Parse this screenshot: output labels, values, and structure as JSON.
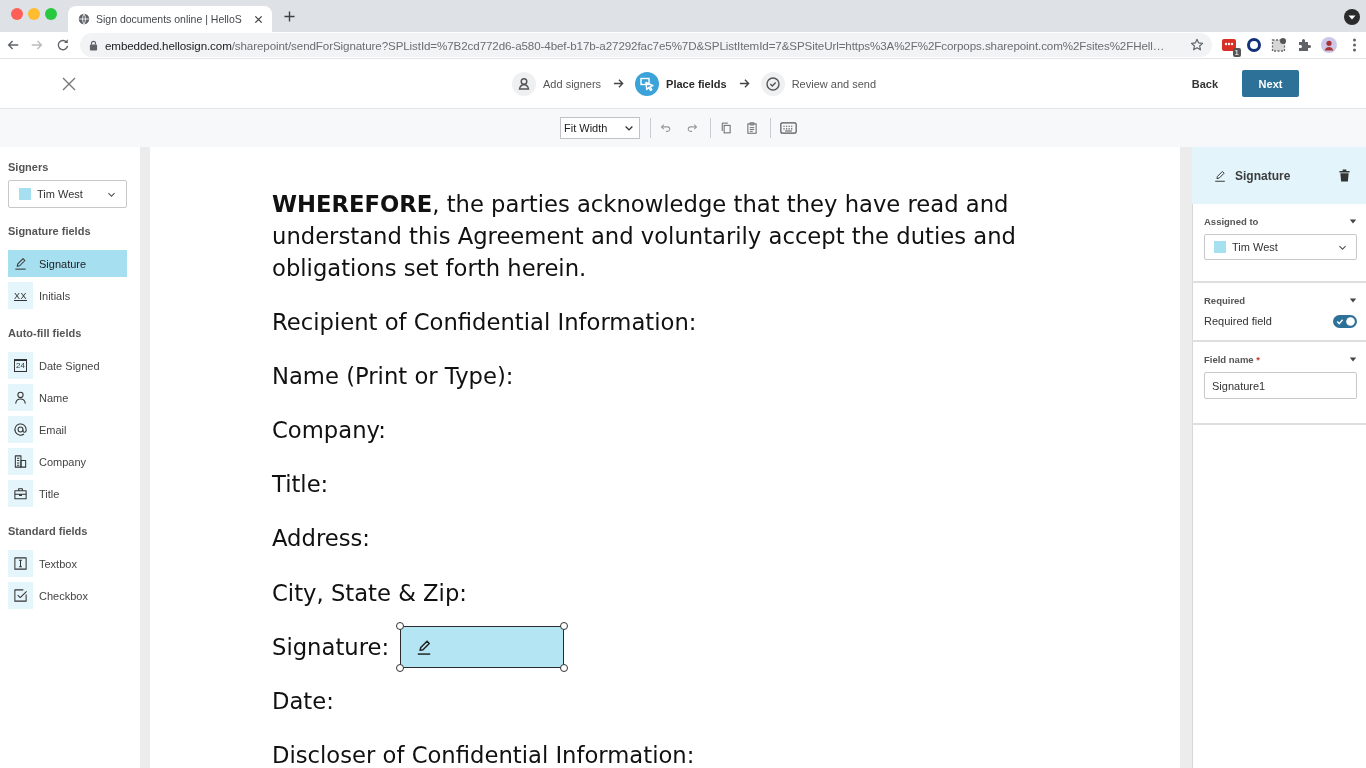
{
  "browser": {
    "tab_title": "Sign documents online | HelloS",
    "forward_disabled": true,
    "url_host": "embedded.hellosign.com",
    "url_path": "/sharepoint/sendForSignature?SPListId=%7B2cd772d6-a580-4bef-b17b-a27292fac7e5%7D&SPListItemId=7&SPSiteUrl=https%3A%2F%2Fcorpops.sharepoint.com%2Fsites%2FHell…",
    "extension_badge": "1"
  },
  "header": {
    "steps": [
      {
        "kind": "signers",
        "label": "Add signers",
        "selected": false
      },
      {
        "kind": "fields",
        "label": "Place fields",
        "selected": true
      },
      {
        "kind": "review",
        "label": "Review and send",
        "selected": false
      }
    ],
    "back": "Back",
    "next": "Next"
  },
  "toolbar": {
    "zoom": "Fit Width"
  },
  "sidebar": {
    "signers_title": "Signers",
    "signer": {
      "name": "Tim West",
      "color": "#a6dff0"
    },
    "groups": [
      {
        "title": "Signature fields",
        "items": [
          {
            "kind": "signature",
            "label": "Signature",
            "selected": true
          },
          {
            "kind": "initials",
            "glyph": "XX",
            "label": "Initials",
            "selected": false
          }
        ]
      },
      {
        "title": "Auto-fill fields",
        "items": [
          {
            "kind": "date",
            "glyph": "24",
            "label": "Date Signed",
            "selected": false
          },
          {
            "kind": "name",
            "label": "Name",
            "selected": false
          },
          {
            "kind": "email",
            "label": "Email",
            "selected": false
          },
          {
            "kind": "company",
            "label": "Company",
            "selected": false
          },
          {
            "kind": "title",
            "label": "Title",
            "selected": false
          }
        ]
      },
      {
        "title": "Standard fields",
        "items": [
          {
            "kind": "textbox",
            "label": "Textbox",
            "selected": false
          },
          {
            "kind": "checkbox",
            "label": "Checkbox",
            "selected": false
          }
        ]
      }
    ]
  },
  "document": {
    "intro": "**WHEREFORE**, the parties acknowledge that they have read and understand this Agreement and voluntarily accept the duties and obligations set forth herein.",
    "lines": [
      {
        "label": "Recipient of Confidential Information:"
      },
      {
        "label": "Name (Print or Type):"
      },
      {
        "label": "Company:"
      },
      {
        "label": "Title:"
      },
      {
        "label": "Address:"
      },
      {
        "label": "City, State & Zip:"
      },
      {
        "label": "Signature:",
        "field": {
          "kind": "signature",
          "selected": true
        }
      },
      {
        "label": "Date:"
      },
      {
        "label": "Discloser of Confidential Information:"
      }
    ]
  },
  "properties": {
    "title": "Signature",
    "sections": [
      {
        "kind": "select",
        "title": "Assigned to",
        "expanded": true,
        "value": "Tim West",
        "color": "#a6dff0"
      },
      {
        "kind": "toggle",
        "title": "Required",
        "expanded": true,
        "label": "Required field",
        "on": true
      },
      {
        "kind": "input",
        "title": "Field name",
        "asterisk": "*",
        "expanded": true,
        "value": "Signature1"
      }
    ]
  }
}
